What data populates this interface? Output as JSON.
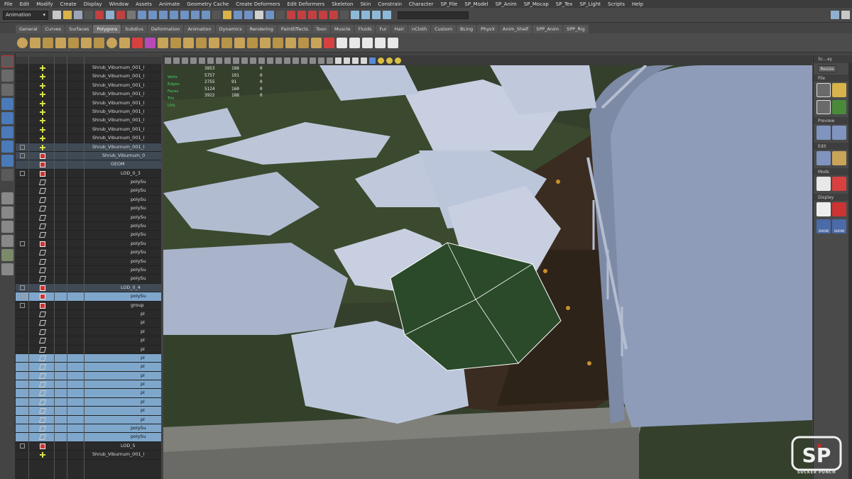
{
  "menubar": [
    "File",
    "Edit",
    "Modify",
    "Create",
    "Display",
    "Window",
    "Assets",
    "Animate",
    "Geometry Cache",
    "Create Deformers",
    "Edit Deformers",
    "Skeleton",
    "Skin",
    "Constrain",
    "Character",
    "SP_File",
    "SP_Model",
    "SP_Anim",
    "SP_Mocap",
    "SP_Tex",
    "SP_Light",
    "Scripts",
    "Help"
  ],
  "statusline": {
    "mode": "Animation"
  },
  "shelf_tabs": [
    {
      "label": "General",
      "active": false
    },
    {
      "label": "Curves",
      "active": false
    },
    {
      "label": "Surfaces",
      "active": false
    },
    {
      "label": "Polygons",
      "active": true
    },
    {
      "label": "Subdivs",
      "active": false
    },
    {
      "label": "Deformation",
      "active": false
    },
    {
      "label": "Animation",
      "active": false
    },
    {
      "label": "Dynamics",
      "active": false
    },
    {
      "label": "Rendering",
      "active": false
    },
    {
      "label": "PaintEffects",
      "active": false
    },
    {
      "label": "Toon",
      "active": false
    },
    {
      "label": "Muscle",
      "active": false
    },
    {
      "label": "Fluids",
      "active": false
    },
    {
      "label": "Fur",
      "active": false
    },
    {
      "label": "Hair",
      "active": false
    },
    {
      "label": "nCloth",
      "active": false
    },
    {
      "label": "Custom",
      "active": false
    },
    {
      "label": "BLing",
      "active": false
    },
    {
      "label": "PhysX",
      "active": false
    },
    {
      "label": "Anim_Shelf",
      "active": false
    },
    {
      "label": "SPP_Anim",
      "active": false
    },
    {
      "label": "SPP_Rig",
      "active": false
    }
  ],
  "outliner": {
    "rows": [
      {
        "label": "Shrub_Viburnum_001_l",
        "indent": 108,
        "icon": "plus",
        "state": "none",
        "box": false
      },
      {
        "label": "Shrub_Viburnum_001_l",
        "indent": 108,
        "icon": "plus",
        "state": "none",
        "box": false
      },
      {
        "label": "Shrub_Viburnum_001_l",
        "indent": 108,
        "icon": "plus",
        "state": "none",
        "box": false
      },
      {
        "label": "Shrub_Viburnum_001_l",
        "indent": 108,
        "icon": "plus",
        "state": "none",
        "box": false
      },
      {
        "label": "Shrub_Viburnum_001_l",
        "indent": 108,
        "icon": "plus",
        "state": "none",
        "box": false
      },
      {
        "label": "Shrub_Viburnum_001_l",
        "indent": 108,
        "icon": "plus",
        "state": "none",
        "box": false
      },
      {
        "label": "Shrub_Viburnum_001_l",
        "indent": 108,
        "icon": "plus",
        "state": "none",
        "box": false
      },
      {
        "label": "Shrub_Viburnum_001_l",
        "indent": 108,
        "icon": "plus",
        "state": "none",
        "box": false
      },
      {
        "label": "Shrub_Viburnum_001_l",
        "indent": 108,
        "icon": "plus",
        "state": "none",
        "box": false
      },
      {
        "label": "Shrub_Viburnum_001_l",
        "indent": 108,
        "icon": "plus",
        "state": "hl",
        "box": true
      },
      {
        "label": "Shrub_Viburnum_0",
        "indent": 122,
        "icon": "red",
        "state": "hl",
        "box": true
      },
      {
        "label": "GEOM",
        "indent": 134,
        "icon": "red",
        "state": "hl",
        "box": false
      },
      {
        "label": "LOD_0_3",
        "indent": 148,
        "icon": "red",
        "state": "none",
        "box": true
      },
      {
        "label": "polySu",
        "indent": 162,
        "icon": "mesh",
        "state": "none",
        "box": false
      },
      {
        "label": "polySu",
        "indent": 162,
        "icon": "mesh",
        "state": "none",
        "box": false
      },
      {
        "label": "polySu",
        "indent": 162,
        "icon": "mesh",
        "state": "none",
        "box": false
      },
      {
        "label": "polySu",
        "indent": 162,
        "icon": "mesh",
        "state": "none",
        "box": false
      },
      {
        "label": "polySu",
        "indent": 162,
        "icon": "mesh",
        "state": "none",
        "box": false
      },
      {
        "label": "polySu",
        "indent": 162,
        "icon": "mesh",
        "state": "none",
        "box": false
      },
      {
        "label": "polySu",
        "indent": 162,
        "icon": "mesh",
        "state": "none",
        "box": false
      },
      {
        "label": "polySu",
        "indent": 162,
        "icon": "red",
        "state": "none",
        "box": true
      },
      {
        "label": "polySu",
        "indent": 162,
        "icon": "mesh",
        "state": "none",
        "box": false
      },
      {
        "label": "polySu",
        "indent": 162,
        "icon": "mesh",
        "state": "none",
        "box": false
      },
      {
        "label": "polySu",
        "indent": 162,
        "icon": "mesh",
        "state": "none",
        "box": false
      },
      {
        "label": "polySu",
        "indent": 162,
        "icon": "mesh",
        "state": "none",
        "box": false
      },
      {
        "label": "LOD_0_4",
        "indent": 148,
        "icon": "red",
        "state": "hl",
        "box": true
      },
      {
        "label": "polySu",
        "indent": 162,
        "icon": "red",
        "state": "sel",
        "box": true
      },
      {
        "label": "group",
        "indent": 162,
        "icon": "red",
        "state": "none",
        "box": true
      },
      {
        "label": "pl",
        "indent": 176,
        "icon": "mesh",
        "state": "none",
        "box": false
      },
      {
        "label": "pl",
        "indent": 176,
        "icon": "mesh",
        "state": "none",
        "box": false
      },
      {
        "label": "pl",
        "indent": 176,
        "icon": "mesh",
        "state": "none",
        "box": false
      },
      {
        "label": "pl",
        "indent": 176,
        "icon": "mesh",
        "state": "none",
        "box": false
      },
      {
        "label": "pl",
        "indent": 176,
        "icon": "mesh",
        "state": "none",
        "box": false
      },
      {
        "label": "pl",
        "indent": 176,
        "icon": "mesh",
        "state": "sel",
        "box": false
      },
      {
        "label": "pl",
        "indent": 176,
        "icon": "mesh",
        "state": "sel",
        "box": false
      },
      {
        "label": "pl",
        "indent": 176,
        "icon": "mesh",
        "state": "sel",
        "box": false
      },
      {
        "label": "pl",
        "indent": 176,
        "icon": "mesh",
        "state": "sel",
        "box": false
      },
      {
        "label": "pl",
        "indent": 176,
        "icon": "mesh",
        "state": "sel",
        "box": false
      },
      {
        "label": "pl",
        "indent": 176,
        "icon": "mesh",
        "state": "sel",
        "box": false
      },
      {
        "label": "pl",
        "indent": 176,
        "icon": "mesh",
        "state": "sel",
        "box": false
      },
      {
        "label": "pl",
        "indent": 176,
        "icon": "mesh",
        "state": "sel",
        "box": false
      },
      {
        "label": "polySu",
        "indent": 162,
        "icon": "mesh",
        "state": "sel",
        "box": false
      },
      {
        "label": "polySu",
        "indent": 162,
        "icon": "mesh",
        "state": "sel",
        "box": false
      },
      {
        "label": "LOD_5",
        "indent": 148,
        "icon": "red",
        "state": "none",
        "box": true
      },
      {
        "label": "Shrub_Viburnum_001_l",
        "indent": 108,
        "icon": "plus",
        "state": "none",
        "box": false
      }
    ]
  },
  "hud": {
    "labels": [
      "Verts",
      "Edges",
      "Faces",
      "Tris",
      "UVs"
    ],
    "rows": [
      [
        "3853",
        "188",
        "0"
      ],
      [
        "5757",
        "191",
        "0"
      ],
      [
        "2755",
        "91",
        "0"
      ],
      [
        "5124",
        "160",
        "0"
      ],
      [
        "3922",
        "188",
        "0"
      ]
    ]
  },
  "side_panel": {
    "title": "Sc...ay",
    "resize_label": "Resize",
    "sections": [
      "File",
      "Preview",
      "Edit",
      "Mods",
      "Display"
    ],
    "show_label": "SHOW"
  },
  "logo": {
    "mark": "SP",
    "caption": "SUCKER PUNCH"
  },
  "colors": {
    "selected_row": "#7fa7cc",
    "active_tab": "#6f6f6f",
    "hud_label": "#4fcf6a"
  }
}
